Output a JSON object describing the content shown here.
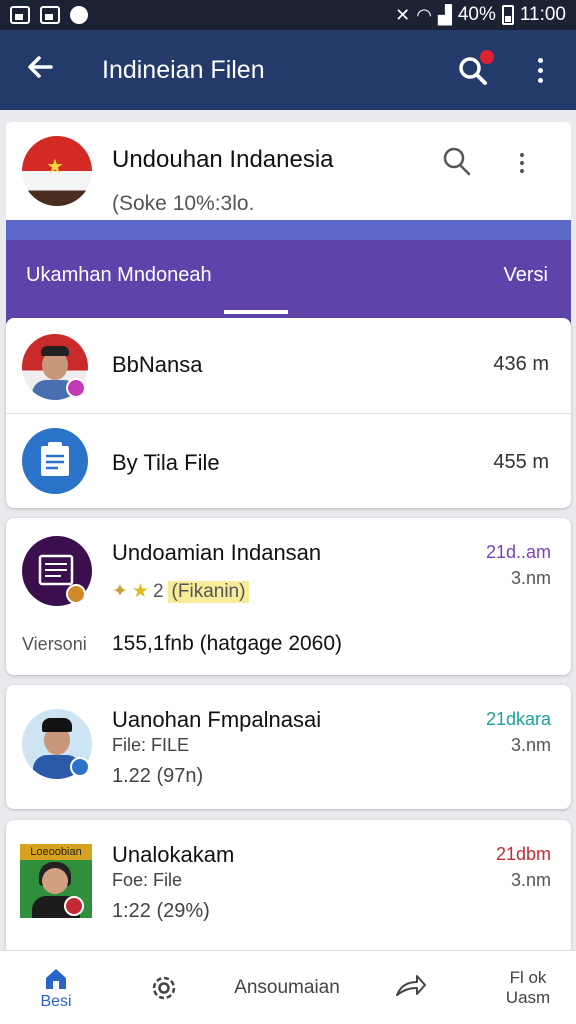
{
  "status_bar": {
    "battery": "40%",
    "time": "11:00"
  },
  "app_bar": {
    "title": "Indineian Filen"
  },
  "top_card": {
    "title": "Undouhan Indanesia",
    "subtitle": "(Soke 10%:3lo.",
    "tab_left": "Ukamhan Mndoneah",
    "tab_right": "Versi"
  },
  "list_card_1": {
    "items": [
      {
        "name": "BbNansa",
        "size": "436 m"
      },
      {
        "name": "By Tila File",
        "size": "455 m"
      }
    ]
  },
  "item_a": {
    "name": "Undoamian Indansan",
    "time": "21d..am",
    "sub": "3.nm",
    "rating_label": "(Fikanin)",
    "rating_prefix": "2",
    "meta_label": "Viersoni",
    "meta_value": "155,1fnb (hatgage 2060)"
  },
  "item_b": {
    "name": "Uanohan Fmpalnasai",
    "line1": "File: FILE",
    "line2": "1.22 (97n)",
    "time": "21dkara",
    "sub": "3.nm"
  },
  "item_c": {
    "name": "Unalokakam",
    "line1": "Foe: File",
    "line2": "1:22 (29%)",
    "time": "21dbm",
    "sub": "3.nm",
    "thumb_text": "Loeoobian"
  },
  "bottom_nav": {
    "home": "Besi",
    "center": "Ansoumaian",
    "right_top": "Fl ok",
    "right_bottom": "Uasm"
  },
  "colors": {
    "appbar": "#243a6b",
    "purple": "#5e44aa",
    "accent_purple": "#7b3fb0",
    "accent_teal": "#1aa39a",
    "accent_red": "#c42a35",
    "nav_active": "#2b63c9"
  },
  "icons": [
    "back-arrow-icon",
    "search-icon",
    "more-vert-icon",
    "home-icon",
    "gear-icon",
    "share-icon"
  ]
}
